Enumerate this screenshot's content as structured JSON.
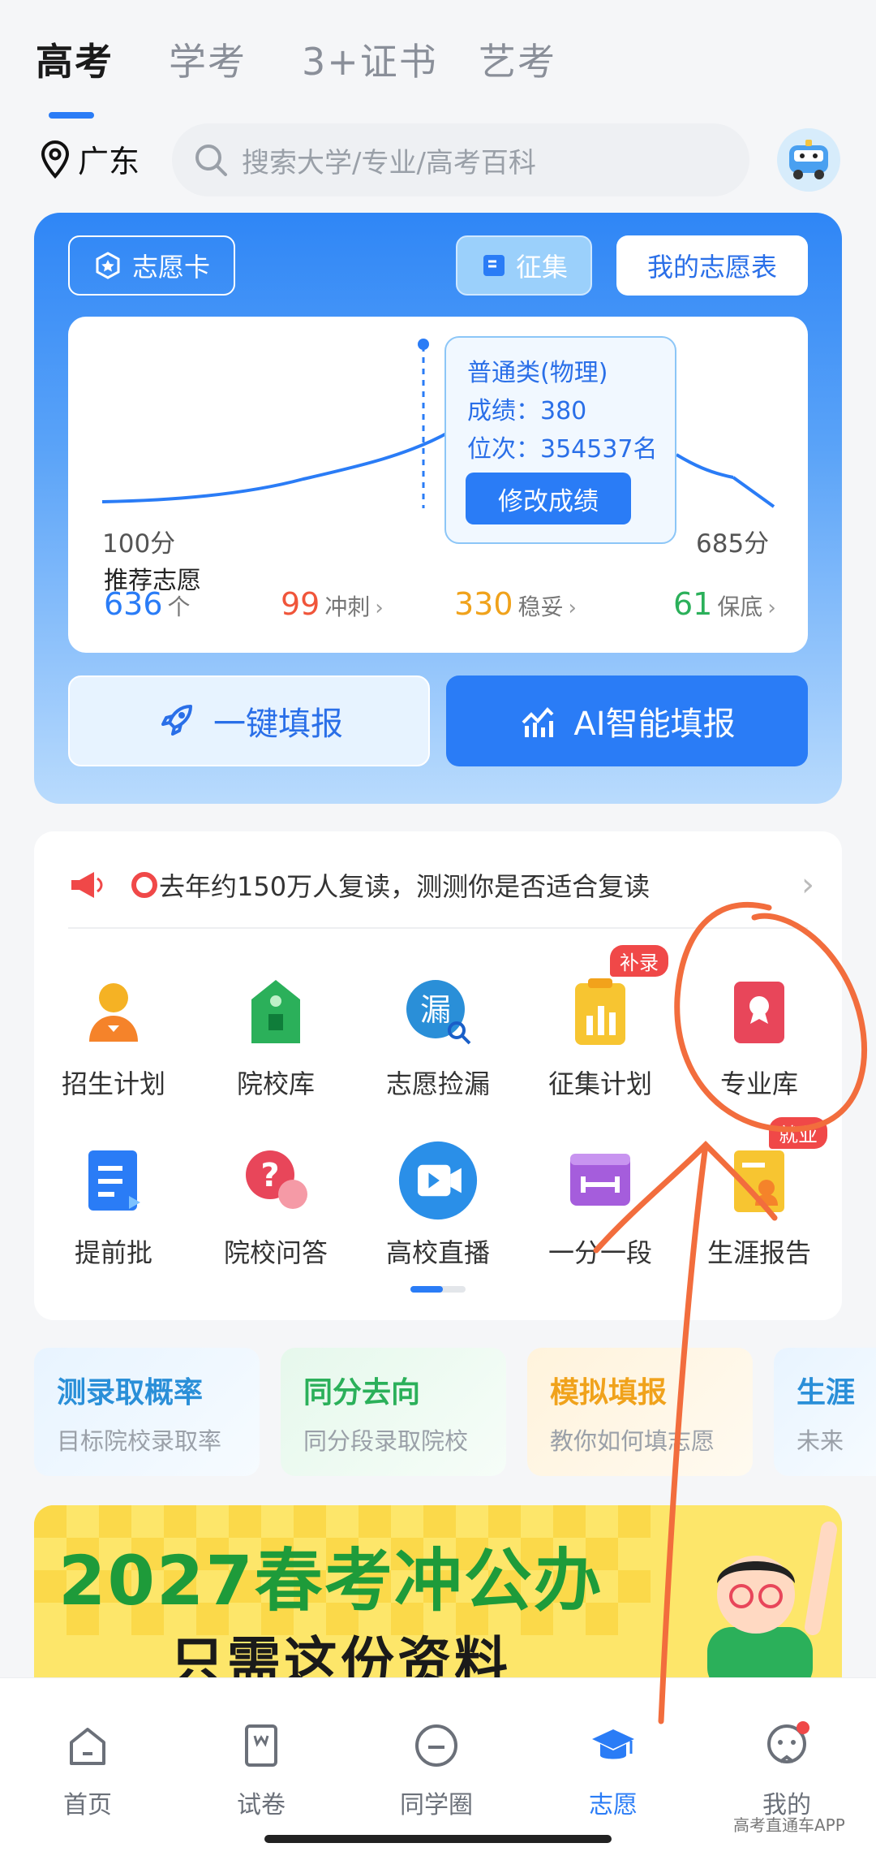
{
  "tabs": [
    "高考",
    "学考",
    "3+证书",
    "艺考"
  ],
  "location": "广东",
  "search_placeholder": "搜索大学/专业/高考百科",
  "card": {
    "volunteer_card": "志愿卡",
    "collect": "征集",
    "my_table": "我的志愿表",
    "tooltip": {
      "category": "普通类(物理)",
      "score": "成绩：380",
      "rank": "位次：354537名",
      "edit": "修改成绩"
    },
    "min_score": "100分",
    "max_score": "685分",
    "recommend_label": "推荐志愿",
    "recommend_count": "636",
    "recommend_unit": "个",
    "sprint": {
      "num": "99",
      "label": "冲刺"
    },
    "safe": {
      "num": "330",
      "label": "稳妥"
    },
    "guarantee": {
      "num": "61",
      "label": "保底"
    },
    "one_click": "一键填报",
    "ai_fill": "AI智能填报"
  },
  "notice": "去年约150万人复读，测测你是否适合复读",
  "grid": [
    {
      "label": "招生计划",
      "icon": "admission-plan-icon"
    },
    {
      "label": "院校库",
      "icon": "school-icon"
    },
    {
      "label": "志愿捡漏",
      "icon": "leak-check-icon"
    },
    {
      "label": "征集计划",
      "icon": "collect-plan-icon",
      "badge": "补录"
    },
    {
      "label": "专业库",
      "icon": "major-library-icon"
    },
    {
      "label": "提前批",
      "icon": "early-batch-icon"
    },
    {
      "label": "院校问答",
      "icon": "qa-icon"
    },
    {
      "label": "高校直播",
      "icon": "live-icon"
    },
    {
      "label": "一分一段",
      "icon": "score-segment-icon"
    },
    {
      "label": "生涯报告",
      "icon": "career-report-icon",
      "badge": "就业"
    }
  ],
  "shortcuts": [
    {
      "title": "测录取概率",
      "sub": "目标院校录取率",
      "color": "#2a8fd8"
    },
    {
      "title": "同分去向",
      "sub": "同分段录取院校",
      "color": "#2bb05a"
    },
    {
      "title": "模拟填报",
      "sub": "教你如何填志愿",
      "color": "#f0a21b"
    },
    {
      "title": "生涯",
      "sub": "未来",
      "color": "#2a8fd8"
    }
  ],
  "banner": {
    "line1": "2027春考冲公办",
    "line2": "只需这份资料"
  },
  "nav": [
    {
      "label": "首页",
      "icon": "home-icon"
    },
    {
      "label": "试卷",
      "icon": "exam-paper-icon"
    },
    {
      "label": "同学圈",
      "icon": "chat-icon"
    },
    {
      "label": "志愿",
      "icon": "graduation-cap-icon",
      "active": true
    },
    {
      "label": "我的",
      "icon": "profile-icon"
    }
  ],
  "watermark": "高考直通车APP"
}
